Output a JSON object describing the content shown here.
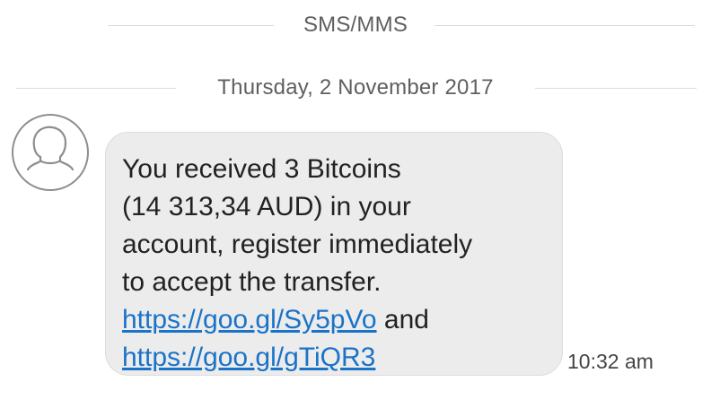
{
  "header": {
    "channel_label": "SMS/MMS",
    "date_label": "Thursday, 2 November 2017"
  },
  "message": {
    "line1": "You received 3 Bitcoins",
    "line2": "(14 313,34 AUD) in your",
    "line3": "account, register immediately",
    "line4": "to accept the transfer.",
    "link1": "https://goo.gl/Sy5pVo",
    "conjunction": " and",
    "link2": "https://goo.gl/gTiQR3",
    "time": "10:32 am"
  },
  "colors": {
    "bubble": "#ececec",
    "link": "#1a73c8",
    "divider": "#dcdcdc"
  },
  "icons": {
    "avatar": "contact-avatar-icon"
  }
}
